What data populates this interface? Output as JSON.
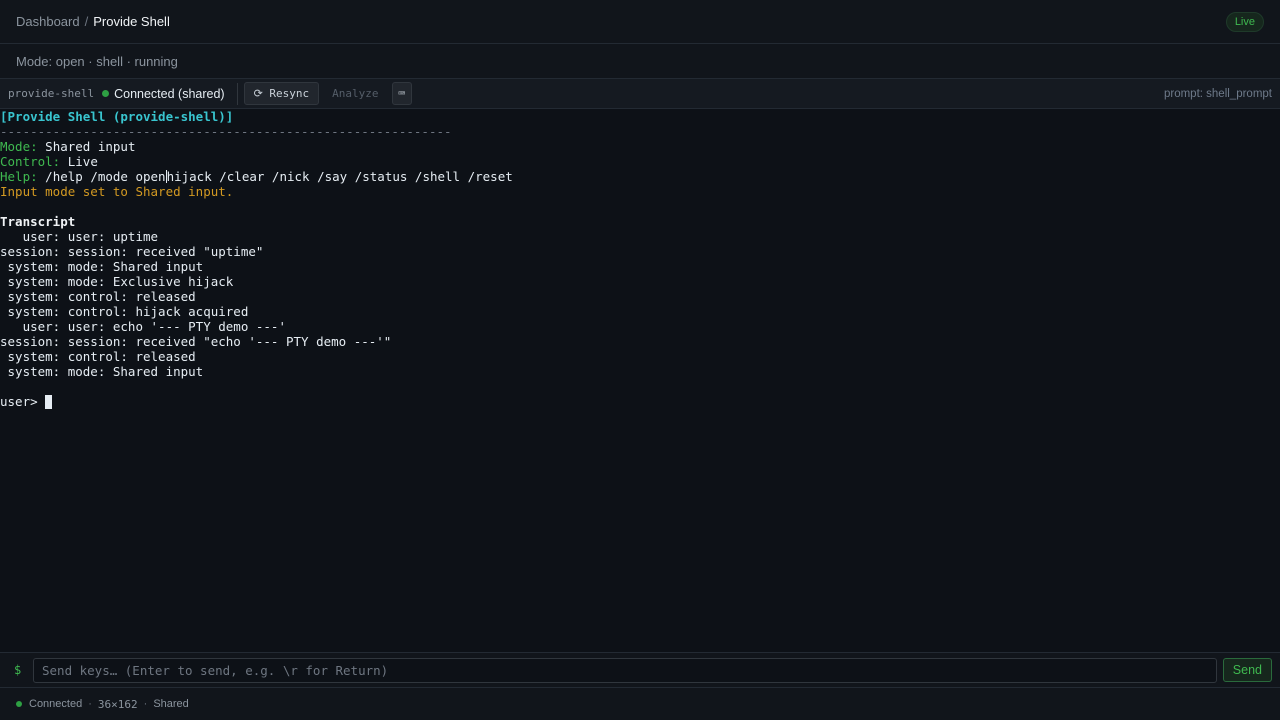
{
  "breadcrumb": {
    "parent": "Dashboard",
    "separator": "/",
    "current": "Provide Shell"
  },
  "live_badge": "Live",
  "mode_line": "Mode: open · shell · running",
  "toolbar": {
    "session_name": "provide-shell",
    "connection": "Connected (shared)",
    "resync_label": "⟳ Resync",
    "analyze_label": "Analyze",
    "keyboard_label": "⌨",
    "prompt_label": "prompt: shell_prompt"
  },
  "terminal": {
    "title": "[Provide Shell (provide-shell)]",
    "rule": "------------------------------------------------------------",
    "mode_label": "Mode:",
    "mode_value": " Shared input",
    "control_label": "Control:",
    "control_value": " Live",
    "help_label": "Help:",
    "help_value_a": " /help /mode open",
    "help_value_b": "hijack /clear /nick /say /status /shell /reset",
    "notice": "Input mode set to Shared input.",
    "transcript_heading": "Transcript",
    "transcript": [
      "   user: user: uptime",
      "session: session: received \"uptime\"",
      " system: mode: Shared input",
      " system: mode: Exclusive hijack",
      " system: control: released",
      " system: control: hijack acquired",
      "   user: user: echo '--- PTY demo ---'",
      "session: session: received \"echo '--- PTY demo ---'\"",
      " system: control: released",
      " system: mode: Shared input"
    ],
    "prompt": "user> "
  },
  "input": {
    "prefix": "$",
    "placeholder": "Send keys… (Enter to send, e.g. \\r for Return)",
    "value": "",
    "send_label": "Send"
  },
  "status": {
    "connection": "Connected",
    "separator": "·",
    "dimensions": "36×162",
    "mode": "Shared"
  },
  "colors": {
    "accent_green": "#3fb950",
    "title_cyan": "#39c5cf",
    "notice_orange": "#d29922",
    "background": "#0d1117"
  }
}
